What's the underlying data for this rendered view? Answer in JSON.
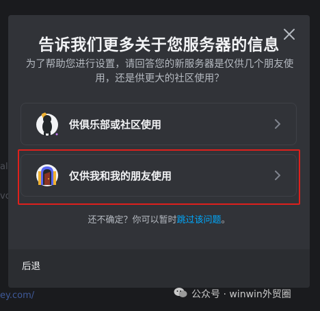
{
  "dialog": {
    "title": "告诉我们更多关于您服务器的信息",
    "subtitle": "为了帮助您进行设置，请回答您的新服务器是仅供几个朋友使用，还是供更大的社区使用？",
    "options": [
      {
        "label": "供俱乐部或社区使用",
        "avatar_icon": "club-community-icon"
      },
      {
        "label": "仅供我和我的朋友使用",
        "avatar_icon": "friends-door-icon"
      }
    ],
    "hint_prefix": "还不确定？你可以暂时",
    "hint_link": "跳过该问题",
    "hint_suffix": "。",
    "back_label": "后退",
    "close_icon": "close-icon"
  },
  "background_fragments": [
    "al",
    "vo",
    "ey.com/"
  ],
  "watermark": {
    "text": "公众号 · winwin外贸圈",
    "icon": "wechat-icon"
  },
  "colors": {
    "modal_bg": "#313338",
    "footer_bg": "#2b2d31",
    "highlight": "#e0201c",
    "link": "#00a8fc"
  }
}
